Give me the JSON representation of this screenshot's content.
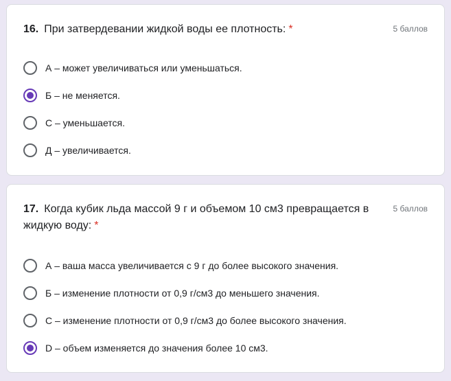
{
  "questions": [
    {
      "number": "16.",
      "title": "При затвердевании жидкой воды ее плотность:",
      "required_mark": "*",
      "points": "5 баллов",
      "options": [
        {
          "label": "А – может увеличиваться или уменьшаться.",
          "selected": false
        },
        {
          "label": "Б – не меняется.",
          "selected": true
        },
        {
          "label": "С – уменьшается.",
          "selected": false
        },
        {
          "label": "Д – увеличивается.",
          "selected": false
        }
      ]
    },
    {
      "number": "17.",
      "title": "Когда кубик льда массой 9 г и объемом 10 см3 превращается в жидкую воду:",
      "required_mark": "*",
      "points": "5 баллов",
      "options": [
        {
          "label": "А – ваша масса увеличивается с 9 г до более высокого значения.",
          "selected": false
        },
        {
          "label": "Б – изменение плотности от 0,9 г/см3 до меньшего значения.",
          "selected": false
        },
        {
          "label": "С – изменение плотности от 0,9 г/см3 до более высокого значения.",
          "selected": false
        },
        {
          "label": "D – объем изменяется до значения более 10 см3.",
          "selected": true
        }
      ]
    }
  ],
  "colors": {
    "accent": "#673ab7",
    "required": "#d93025",
    "background": "#ebe7f4"
  }
}
